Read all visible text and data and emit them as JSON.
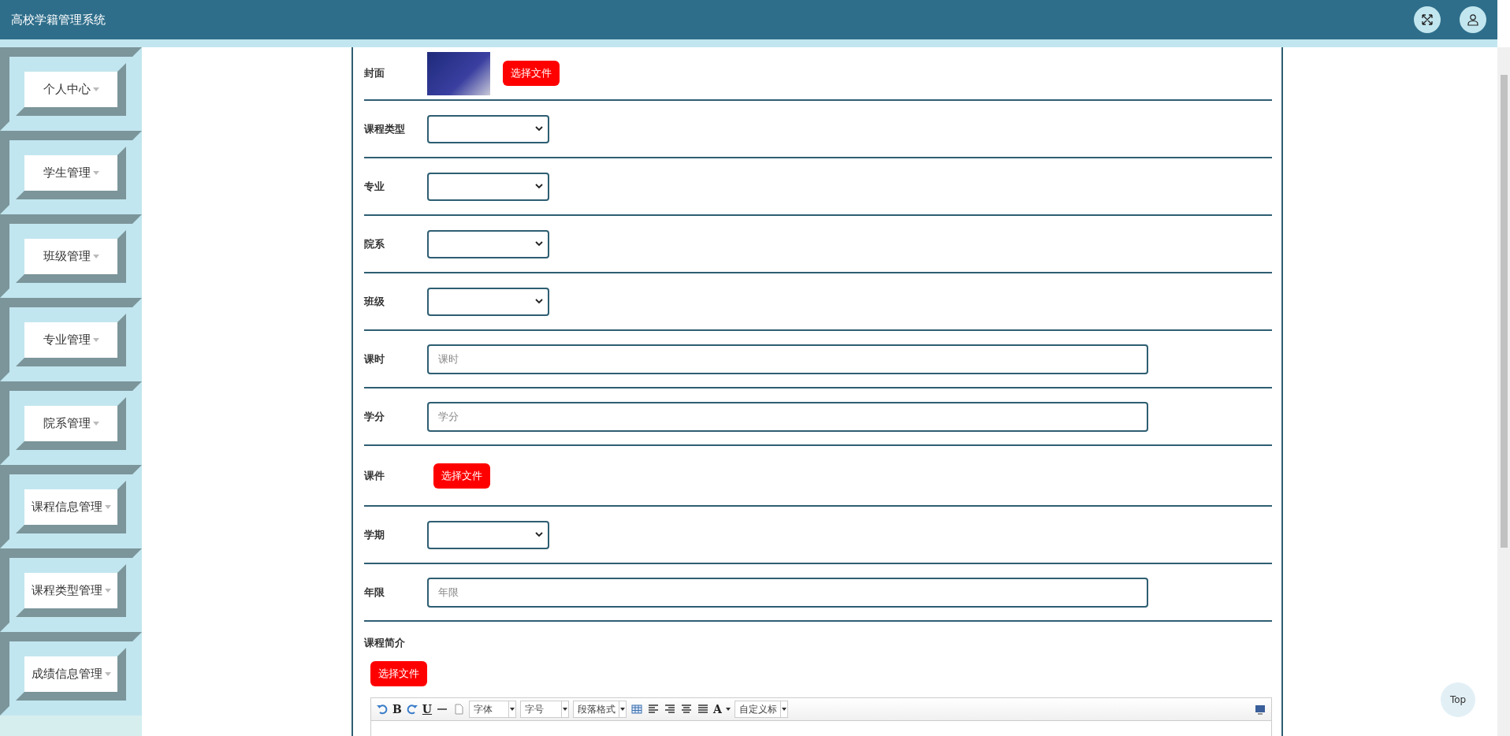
{
  "header": {
    "title": "高校学籍管理系统"
  },
  "sidebar": {
    "items": [
      {
        "label": "个人中心"
      },
      {
        "label": "学生管理"
      },
      {
        "label": "班级管理"
      },
      {
        "label": "专业管理"
      },
      {
        "label": "院系管理"
      },
      {
        "label": "课程信息管理"
      },
      {
        "label": "课程类型管理"
      },
      {
        "label": "成绩信息管理"
      }
    ]
  },
  "form": {
    "rows": [
      {
        "kind": "image",
        "label": "封面",
        "button": "选择文件"
      },
      {
        "kind": "select",
        "label": "课程类型"
      },
      {
        "kind": "select",
        "label": "专业"
      },
      {
        "kind": "select",
        "label": "院系"
      },
      {
        "kind": "select",
        "label": "班级"
      },
      {
        "kind": "input",
        "label": "课时",
        "placeholder": "课时"
      },
      {
        "kind": "input",
        "label": "学分",
        "placeholder": "学分"
      },
      {
        "kind": "file",
        "label": "课件",
        "button": "选择文件"
      },
      {
        "kind": "select",
        "label": "学期"
      },
      {
        "kind": "input",
        "label": "年限",
        "placeholder": "年限"
      },
      {
        "kind": "editor",
        "label": "课程简介",
        "button": "选择文件"
      }
    ]
  },
  "editor": {
    "glyphs": [
      "B",
      "U",
      "A"
    ],
    "dropdowns": [
      "字体",
      "字号",
      "段落格式",
      "自定义标"
    ]
  },
  "top_button": "Top"
}
